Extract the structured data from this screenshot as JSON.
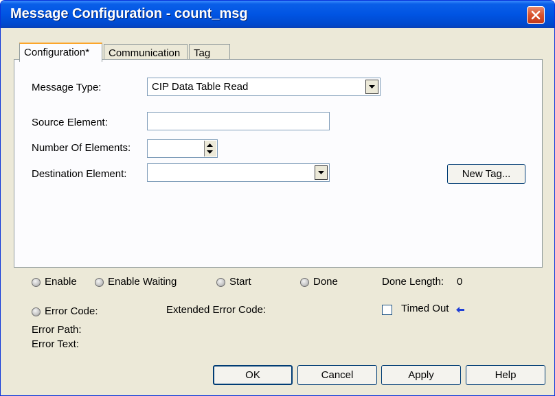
{
  "window": {
    "title": "Message Configuration - count_msg"
  },
  "tabs": [
    {
      "label": "Configuration*",
      "active": true
    },
    {
      "label": "Communication",
      "active": false
    },
    {
      "label": "Tag",
      "active": false
    }
  ],
  "config": {
    "message_type_label": "Message Type:",
    "message_type_value": "CIP Data Table Read",
    "source_element_label": "Source Element:",
    "source_element_value": "",
    "number_of_elements_label": "Number Of Elements:",
    "number_of_elements_value": "",
    "destination_element_label": "Destination Element:",
    "destination_element_value": "",
    "new_tag_button": "New Tag..."
  },
  "status": {
    "enable": "Enable",
    "enable_waiting": "Enable Waiting",
    "start": "Start",
    "done": "Done",
    "done_length_label": "Done Length:",
    "done_length_value": "0",
    "error_code_label": "Error Code:",
    "extended_error_code_label": "Extended Error Code:",
    "timed_out_label": "Timed Out",
    "timed_out_checked": false,
    "error_path_label": "Error Path:",
    "error_text_label": "Error Text:"
  },
  "buttons": {
    "ok": "OK",
    "cancel": "Cancel",
    "apply": "Apply",
    "help": "Help"
  },
  "colors": {
    "title_bar": "#0054e3",
    "dialog_bg": "#ece9d8",
    "close_button": "#d8522c",
    "tab_highlight": "#fca62a"
  },
  "icons": {
    "close": "close-icon",
    "dropdown": "chevron-down-icon",
    "timed_out_indicator": "arrow-left-icon"
  }
}
